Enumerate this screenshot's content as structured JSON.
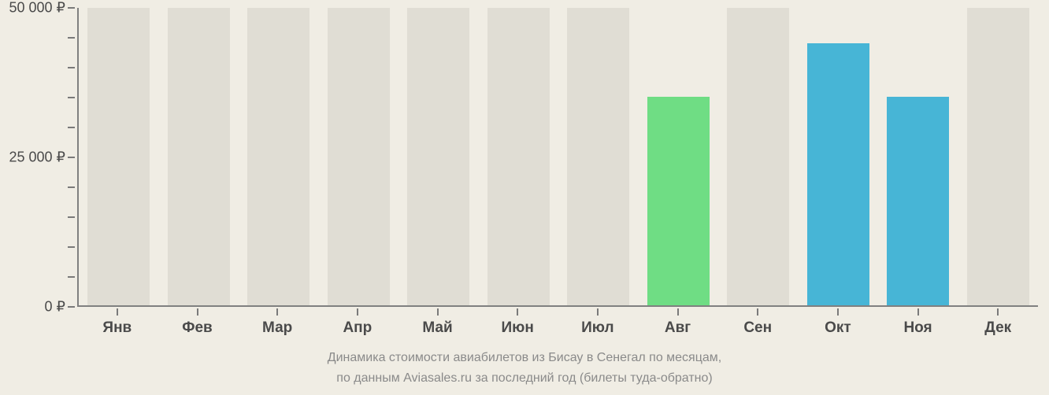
{
  "chart_data": {
    "type": "bar",
    "categories": [
      "Янв",
      "Фев",
      "Мар",
      "Апр",
      "Май",
      "Июн",
      "Июл",
      "Авг",
      "Сен",
      "Окт",
      "Ноя",
      "Дек"
    ],
    "values": [
      null,
      null,
      null,
      null,
      null,
      null,
      null,
      35000,
      null,
      44000,
      35000,
      null
    ],
    "colors": [
      null,
      null,
      null,
      null,
      null,
      null,
      null,
      "green",
      null,
      "blue",
      "blue",
      null
    ],
    "ylim": [
      0,
      50000
    ],
    "y_ticks_major": [
      0,
      25000,
      50000
    ],
    "y_tick_labels": [
      "0 ₽",
      "25 000 ₽",
      "50 000 ₽"
    ],
    "y_ticks_minor": [
      5000,
      10000,
      15000,
      20000,
      30000,
      35000,
      40000,
      45000
    ],
    "title_line1": "Динамика стоимости авиабилетов из Бисау в Сенегал по месяцам,",
    "title_line2": "по данным Aviasales.ru за последний год (билеты туда-обратно)"
  }
}
